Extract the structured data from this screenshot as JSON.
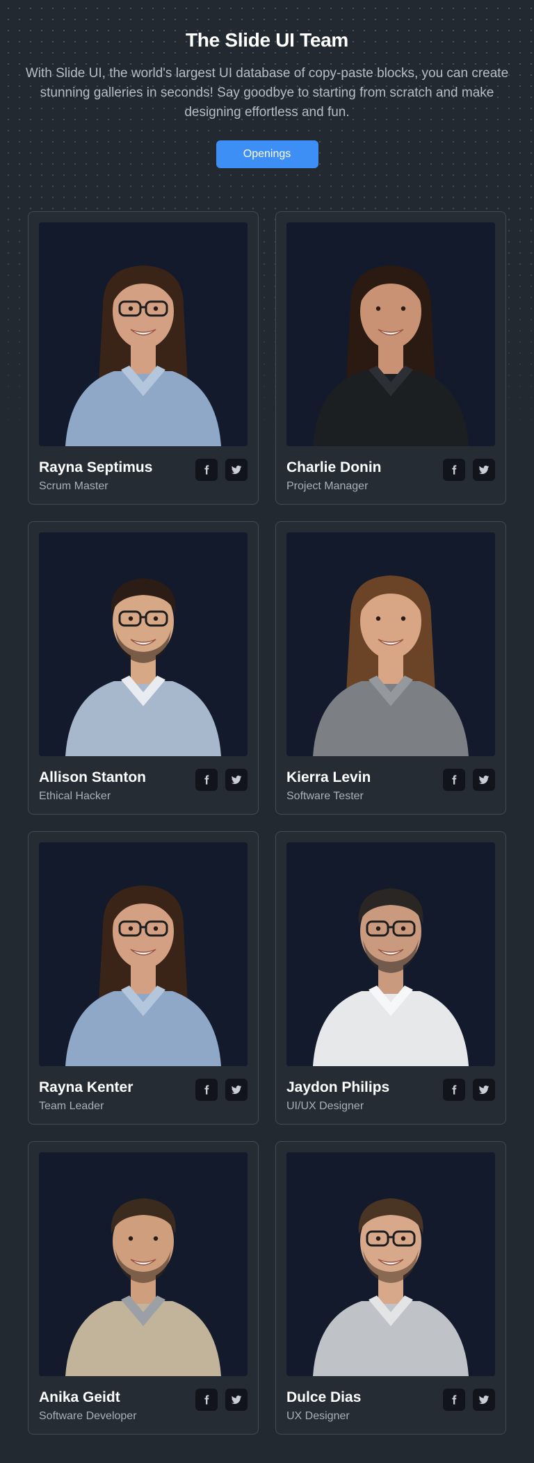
{
  "header": {
    "title": "The Slide UI Team",
    "subtitle": "With Slide UI, the world's largest UI database of copy-paste blocks, you can create stunning galleries in seconds! Say goodbye to starting from scratch and make designing effortless and fun.",
    "button_label": "Openings"
  },
  "colors": {
    "background": "#232931",
    "card_border": "#424a55",
    "photo_bg": "#121a2c",
    "accent": "#3d8ef5",
    "muted_text": "#a9b0ba"
  },
  "icons": [
    "facebook-icon",
    "twitter-icon"
  ],
  "team": [
    {
      "name": "Rayna Septimus",
      "role": "Scrum Master"
    },
    {
      "name": "Charlie Donin",
      "role": "Project Manager"
    },
    {
      "name": "Allison Stanton",
      "role": "Ethical Hacker"
    },
    {
      "name": "Kierra Levin",
      "role": "Software Tester"
    },
    {
      "name": "Rayna Kenter",
      "role": "Team Leader"
    },
    {
      "name": "Jaydon Philips",
      "role": "UI/UX Designer"
    },
    {
      "name": "Anika Geidt",
      "role": "Software Developer"
    },
    {
      "name": "Dulce Dias",
      "role": "UX Designer"
    }
  ]
}
